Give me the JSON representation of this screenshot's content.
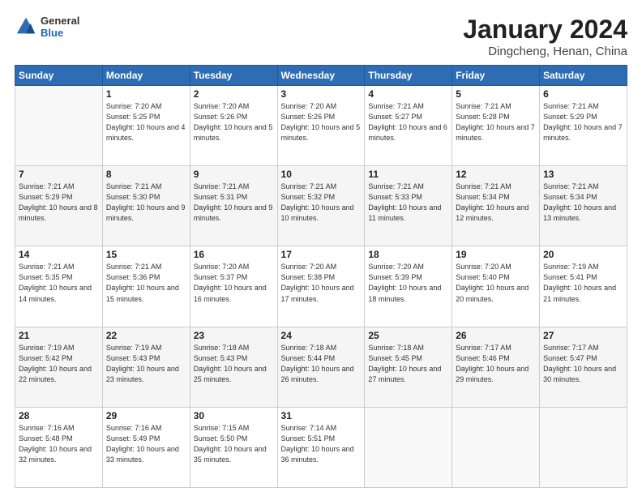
{
  "header": {
    "logo": {
      "general": "General",
      "blue": "Blue"
    },
    "title": "January 2024",
    "subtitle": "Dingcheng, Henan, China"
  },
  "days_header": [
    "Sunday",
    "Monday",
    "Tuesday",
    "Wednesday",
    "Thursday",
    "Friday",
    "Saturday"
  ],
  "weeks": [
    [
      {
        "day": "",
        "info": ""
      },
      {
        "day": "1",
        "info": "Sunrise: 7:20 AM\nSunset: 5:25 PM\nDaylight: 10 hours\nand 4 minutes."
      },
      {
        "day": "2",
        "info": "Sunrise: 7:20 AM\nSunset: 5:26 PM\nDaylight: 10 hours\nand 5 minutes."
      },
      {
        "day": "3",
        "info": "Sunrise: 7:20 AM\nSunset: 5:26 PM\nDaylight: 10 hours\nand 5 minutes."
      },
      {
        "day": "4",
        "info": "Sunrise: 7:21 AM\nSunset: 5:27 PM\nDaylight: 10 hours\nand 6 minutes."
      },
      {
        "day": "5",
        "info": "Sunrise: 7:21 AM\nSunset: 5:28 PM\nDaylight: 10 hours\nand 7 minutes."
      },
      {
        "day": "6",
        "info": "Sunrise: 7:21 AM\nSunset: 5:29 PM\nDaylight: 10 hours\nand 7 minutes."
      }
    ],
    [
      {
        "day": "7",
        "info": "Sunrise: 7:21 AM\nSunset: 5:29 PM\nDaylight: 10 hours\nand 8 minutes."
      },
      {
        "day": "8",
        "info": "Sunrise: 7:21 AM\nSunset: 5:30 PM\nDaylight: 10 hours\nand 9 minutes."
      },
      {
        "day": "9",
        "info": "Sunrise: 7:21 AM\nSunset: 5:31 PM\nDaylight: 10 hours\nand 9 minutes."
      },
      {
        "day": "10",
        "info": "Sunrise: 7:21 AM\nSunset: 5:32 PM\nDaylight: 10 hours\nand 10 minutes."
      },
      {
        "day": "11",
        "info": "Sunrise: 7:21 AM\nSunset: 5:33 PM\nDaylight: 10 hours\nand 11 minutes."
      },
      {
        "day": "12",
        "info": "Sunrise: 7:21 AM\nSunset: 5:34 PM\nDaylight: 10 hours\nand 12 minutes."
      },
      {
        "day": "13",
        "info": "Sunrise: 7:21 AM\nSunset: 5:34 PM\nDaylight: 10 hours\nand 13 minutes."
      }
    ],
    [
      {
        "day": "14",
        "info": "Sunrise: 7:21 AM\nSunset: 5:35 PM\nDaylight: 10 hours\nand 14 minutes."
      },
      {
        "day": "15",
        "info": "Sunrise: 7:21 AM\nSunset: 5:36 PM\nDaylight: 10 hours\nand 15 minutes."
      },
      {
        "day": "16",
        "info": "Sunrise: 7:20 AM\nSunset: 5:37 PM\nDaylight: 10 hours\nand 16 minutes."
      },
      {
        "day": "17",
        "info": "Sunrise: 7:20 AM\nSunset: 5:38 PM\nDaylight: 10 hours\nand 17 minutes."
      },
      {
        "day": "18",
        "info": "Sunrise: 7:20 AM\nSunset: 5:39 PM\nDaylight: 10 hours\nand 18 minutes."
      },
      {
        "day": "19",
        "info": "Sunrise: 7:20 AM\nSunset: 5:40 PM\nDaylight: 10 hours\nand 20 minutes."
      },
      {
        "day": "20",
        "info": "Sunrise: 7:19 AM\nSunset: 5:41 PM\nDaylight: 10 hours\nand 21 minutes."
      }
    ],
    [
      {
        "day": "21",
        "info": "Sunrise: 7:19 AM\nSunset: 5:42 PM\nDaylight: 10 hours\nand 22 minutes."
      },
      {
        "day": "22",
        "info": "Sunrise: 7:19 AM\nSunset: 5:43 PM\nDaylight: 10 hours\nand 23 minutes."
      },
      {
        "day": "23",
        "info": "Sunrise: 7:18 AM\nSunset: 5:43 PM\nDaylight: 10 hours\nand 25 minutes."
      },
      {
        "day": "24",
        "info": "Sunrise: 7:18 AM\nSunset: 5:44 PM\nDaylight: 10 hours\nand 26 minutes."
      },
      {
        "day": "25",
        "info": "Sunrise: 7:18 AM\nSunset: 5:45 PM\nDaylight: 10 hours\nand 27 minutes."
      },
      {
        "day": "26",
        "info": "Sunrise: 7:17 AM\nSunset: 5:46 PM\nDaylight: 10 hours\nand 29 minutes."
      },
      {
        "day": "27",
        "info": "Sunrise: 7:17 AM\nSunset: 5:47 PM\nDaylight: 10 hours\nand 30 minutes."
      }
    ],
    [
      {
        "day": "28",
        "info": "Sunrise: 7:16 AM\nSunset: 5:48 PM\nDaylight: 10 hours\nand 32 minutes."
      },
      {
        "day": "29",
        "info": "Sunrise: 7:16 AM\nSunset: 5:49 PM\nDaylight: 10 hours\nand 33 minutes."
      },
      {
        "day": "30",
        "info": "Sunrise: 7:15 AM\nSunset: 5:50 PM\nDaylight: 10 hours\nand 35 minutes."
      },
      {
        "day": "31",
        "info": "Sunrise: 7:14 AM\nSunset: 5:51 PM\nDaylight: 10 hours\nand 36 minutes."
      },
      {
        "day": "",
        "info": ""
      },
      {
        "day": "",
        "info": ""
      },
      {
        "day": "",
        "info": ""
      }
    ]
  ]
}
